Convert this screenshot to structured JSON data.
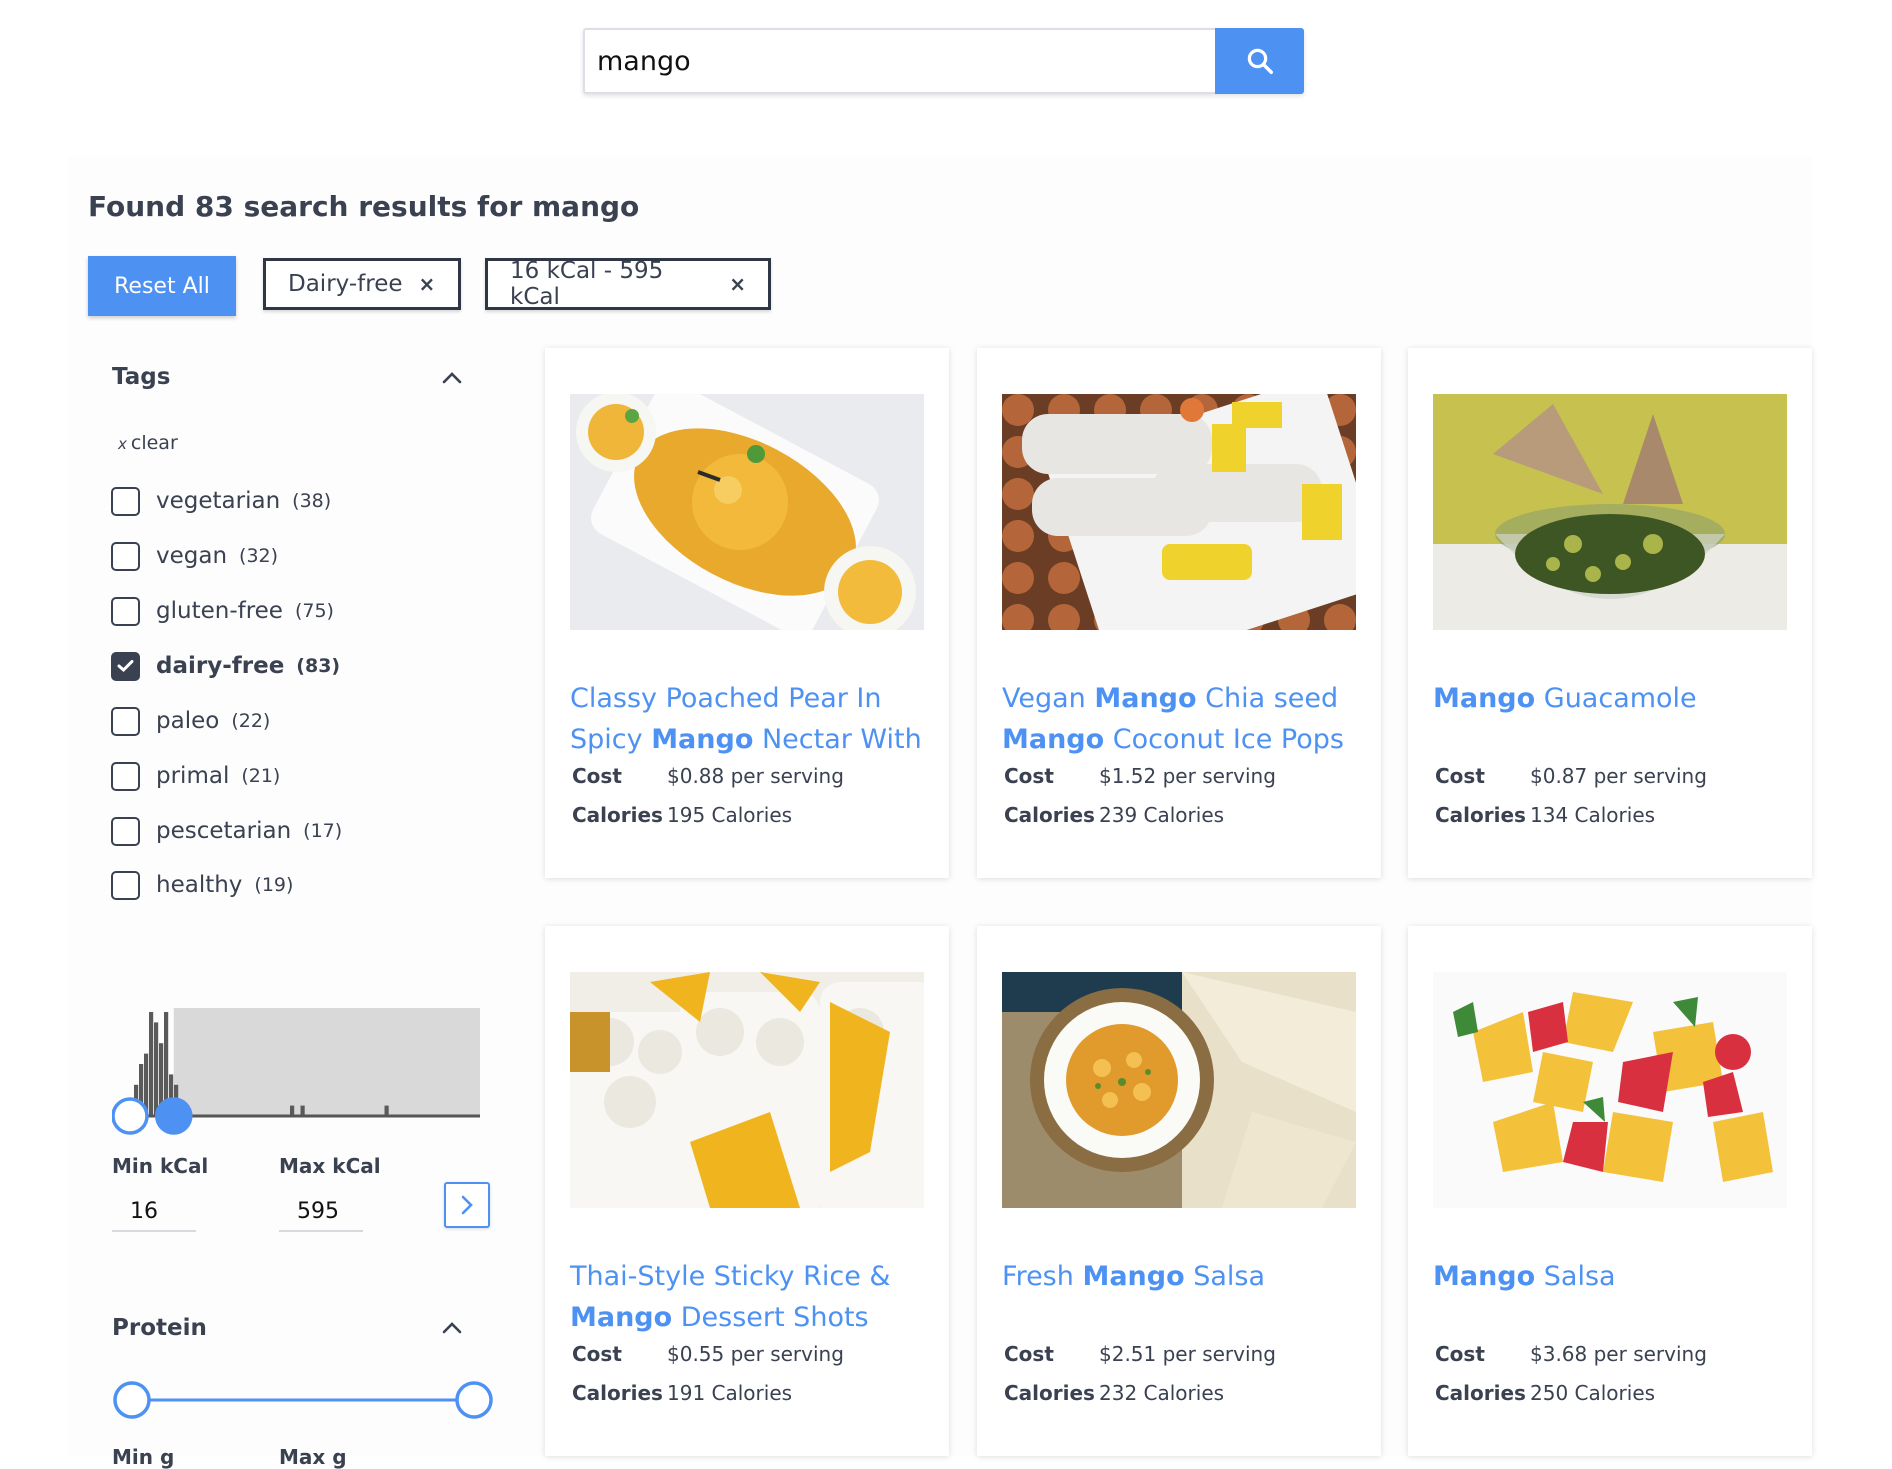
{
  "search": {
    "value": "mango"
  },
  "results_heading": "Found 83 search results for mango",
  "filters": {
    "reset_label": "Reset All",
    "active": [
      {
        "label": "Dairy-free",
        "remove": "×"
      },
      {
        "label": "16 kCal - 595 kCal",
        "remove": "×"
      }
    ]
  },
  "sidebar": {
    "tags": {
      "title": "Tags",
      "clear_icon": "x",
      "clear_label": "clear",
      "items": [
        {
          "label": "vegetarian",
          "count": "(38)",
          "checked": false
        },
        {
          "label": "vegan",
          "count": "(32)",
          "checked": false
        },
        {
          "label": "gluten-free",
          "count": "(75)",
          "checked": false
        },
        {
          "label": "dairy-free",
          "count": "(83)",
          "checked": true
        },
        {
          "label": "paleo",
          "count": "(22)",
          "checked": false
        },
        {
          "label": "primal",
          "count": "(21)",
          "checked": false
        },
        {
          "label": "pescetarian",
          "count": "(17)",
          "checked": false
        },
        {
          "label": "healthy",
          "count": "(19)",
          "checked": false
        }
      ]
    },
    "calories": {
      "min_label": "Min kCal",
      "max_label": "Max kCal",
      "min_value": "16",
      "max_value": "595",
      "histogram": [
        3,
        5,
        6,
        10,
        9,
        7,
        10,
        4,
        3,
        0,
        0,
        0,
        1,
        1,
        0,
        0,
        0,
        0,
        0,
        0,
        0,
        1,
        0,
        0
      ],
      "selected_range_fraction": [
        0.0,
        0.12
      ]
    },
    "protein": {
      "title": "Protein",
      "min_label": "Min g",
      "max_label": "Max g",
      "selected_range_fraction": [
        0.0,
        1.0
      ]
    }
  },
  "recipes": [
    {
      "title_parts": [
        {
          "t": "Classy Poached Pear In Spicy ",
          "b": false
        },
        {
          "t": "Mango",
          "b": true
        },
        {
          "t": " Nectar With",
          "b": false
        }
      ],
      "cost_label": "Cost",
      "cost": "$0.88 per serving",
      "cal_label": "Calories",
      "calories": "195 Calories",
      "image": "mango-sorbet-photo"
    },
    {
      "title_parts": [
        {
          "t": "Vegan ",
          "b": false
        },
        {
          "t": "Mango",
          "b": true
        },
        {
          "t": " Chia seed ",
          "b": false
        },
        {
          "t": "Mango",
          "b": true
        },
        {
          "t": " Coconut Ice Pops",
          "b": false
        }
      ],
      "cost_label": "Cost",
      "cost": "$1.52 per serving",
      "cal_label": "Calories",
      "calories": "239 Calories",
      "image": "ice-pops-photo"
    },
    {
      "title_parts": [
        {
          "t": "Mango",
          "b": true
        },
        {
          "t": " Guacamole",
          "b": false
        }
      ],
      "cost_label": "Cost",
      "cost": "$0.87 per serving",
      "cal_label": "Calories",
      "calories": "134 Calories",
      "image": "guacamole-photo"
    },
    {
      "title_parts": [
        {
          "t": "Thai-Style Sticky Rice & ",
          "b": false
        },
        {
          "t": "Mango",
          "b": true
        },
        {
          "t": " Dessert Shots",
          "b": false
        }
      ],
      "cost_label": "Cost",
      "cost": "$0.55 per serving",
      "cal_label": "Calories",
      "calories": "191 Calories",
      "image": "sticky-rice-photo"
    },
    {
      "title_parts": [
        {
          "t": "Fresh ",
          "b": false
        },
        {
          "t": "Mango",
          "b": true
        },
        {
          "t": " Salsa",
          "b": false
        }
      ],
      "cost_label": "Cost",
      "cost": "$2.51 per serving",
      "cal_label": "Calories",
      "calories": "232 Calories",
      "image": "salsa-bowl-photo"
    },
    {
      "title_parts": [
        {
          "t": "Mango",
          "b": true
        },
        {
          "t": " Salsa",
          "b": false
        }
      ],
      "cost_label": "Cost",
      "cost": "$3.68 per serving",
      "cal_label": "Calories",
      "calories": "250 Calories",
      "image": "fruit-salsa-photo"
    }
  ],
  "colors": {
    "accent": "#4d92f3",
    "text": "#3a4150"
  }
}
